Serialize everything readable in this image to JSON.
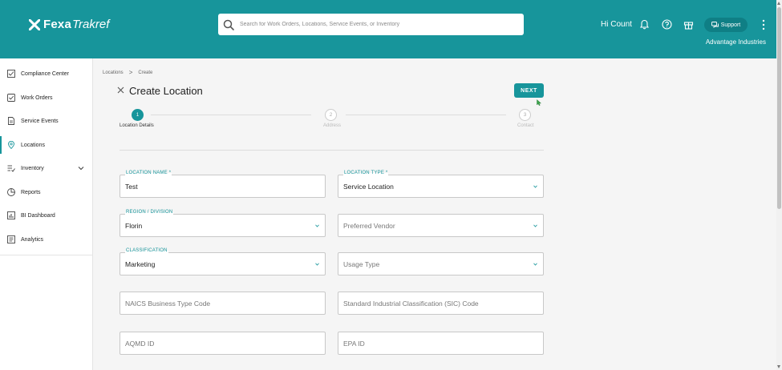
{
  "header": {
    "logo_bold": "Fexa",
    "logo_light": "Trakref",
    "search_placeholder": "Search for Work Orders, Locations, Service Events, or Inventory",
    "greeting": "Hi Count",
    "support_label": "Support",
    "company": "Advantage Industries"
  },
  "sidebar": {
    "items": [
      {
        "label": "Compliance Center",
        "icon": "compliance-icon"
      },
      {
        "label": "Work Orders",
        "icon": "work-orders-icon"
      },
      {
        "label": "Service Events",
        "icon": "service-events-icon"
      },
      {
        "label": "Locations",
        "icon": "location-pin-icon",
        "active": true
      },
      {
        "label": "Inventory",
        "icon": "inventory-icon"
      },
      {
        "label": "Reports",
        "icon": "reports-icon"
      },
      {
        "label": "BI Dashboard",
        "icon": "bi-dashboard-icon"
      },
      {
        "label": "Analytics",
        "icon": "analytics-icon"
      }
    ]
  },
  "breadcrumb": {
    "items": [
      "Locations",
      "Create"
    ],
    "separator": ">"
  },
  "page": {
    "title": "Create Location",
    "next_label": "NEXT"
  },
  "steps": [
    {
      "number": "1",
      "label": "Location Details",
      "active": true
    },
    {
      "number": "2",
      "label": "Address",
      "active": false
    },
    {
      "number": "3",
      "label": "Contact",
      "active": false
    }
  ],
  "form": {
    "location_name": {
      "label": "LOCATION NAME *",
      "value": "Test"
    },
    "location_type": {
      "label": "LOCATION TYPE *",
      "value": "Service Location"
    },
    "region_division": {
      "label": "REGION / DIVISION",
      "value": "Florin"
    },
    "preferred_vendor": {
      "placeholder": "Preferred Vendor"
    },
    "classification": {
      "label": "CLASSIFICATION",
      "value": "Marketing"
    },
    "usage_type": {
      "placeholder": "Usage Type"
    },
    "naics": {
      "placeholder": "NAICS Business Type Code"
    },
    "sic": {
      "placeholder": "Standard Industrial Classification (SIC) Code"
    },
    "aqmd": {
      "placeholder": "AQMD ID"
    },
    "epa": {
      "placeholder": "EPA ID"
    }
  },
  "colors": {
    "brand": "#17959b",
    "support_bg": "#0f7f85"
  }
}
